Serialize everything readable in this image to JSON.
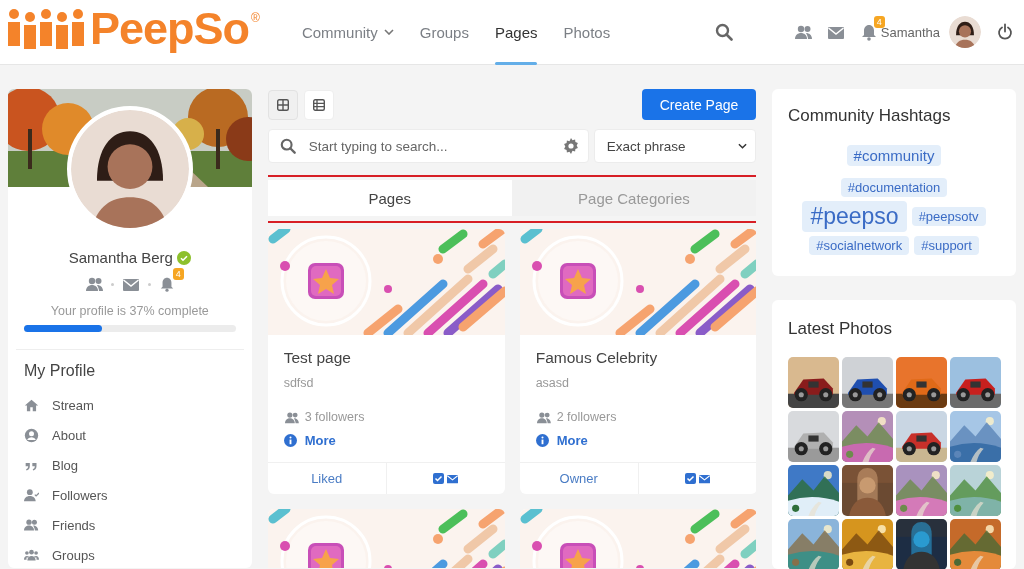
{
  "header": {
    "logo": "PeepSo",
    "logo_mark": "®",
    "nav": [
      {
        "label": "Community",
        "selected": false,
        "dropdown": true
      },
      {
        "label": "Groups",
        "selected": false,
        "dropdown": false
      },
      {
        "label": "Pages",
        "selected": true,
        "dropdown": false
      },
      {
        "label": "Photos",
        "selected": false,
        "dropdown": false
      }
    ],
    "notification_count": "4",
    "user_name": "Samantha"
  },
  "profile": {
    "name": "Samantha Berg",
    "verified": true,
    "notification_count": "4",
    "completion_text": "Your profile is 37% complete",
    "level": 0.37,
    "menu_title": "My Profile",
    "menu": [
      {
        "label": "Stream"
      },
      {
        "label": "About"
      },
      {
        "label": "Blog"
      },
      {
        "label": "Followers"
      },
      {
        "label": "Friends"
      },
      {
        "label": "Groups"
      }
    ]
  },
  "pages": {
    "view_buttons": [
      {
        "kind": "grid",
        "selected": true
      },
      {
        "kind": "list",
        "selected": false
      }
    ],
    "create_button": "Create Page",
    "search": {
      "placeholder": "Start typing to search..."
    },
    "search_mode": "Exact phrase",
    "tabs": [
      {
        "label": "Pages",
        "selected": true
      },
      {
        "label": "Page Categories",
        "selected": false
      }
    ],
    "cards": [
      {
        "kind": "full",
        "title": "Test page",
        "description": "sdfsd",
        "followers": "3 followers",
        "more": "More",
        "status": "Liked"
      },
      {
        "kind": "full",
        "title": "Famous Celebrity",
        "description": "asasd",
        "followers": "2 followers",
        "more": "More",
        "status": "Owner"
      },
      {
        "kind": "cover"
      },
      {
        "kind": "cover"
      }
    ]
  },
  "hashtags": {
    "title": "Community Hashtags",
    "tags": [
      "#community",
      "#documentation",
      "#peepso",
      "#peepsotv",
      "#socialnetwork",
      "#support"
    ]
  },
  "photos": {
    "title": "Latest Photos"
  }
}
